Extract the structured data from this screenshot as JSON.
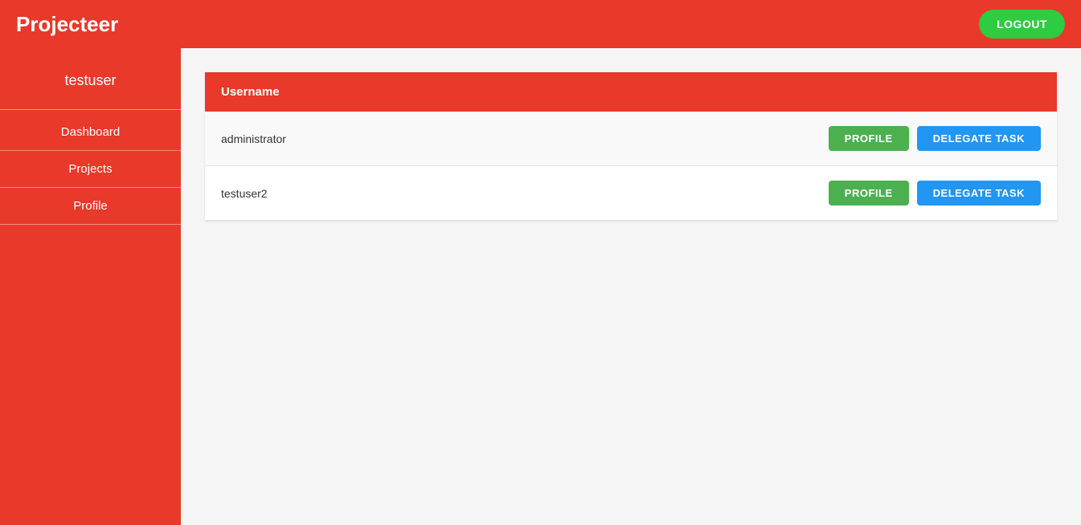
{
  "app": {
    "title": "Projecteer",
    "logout_label": "LOGOUT"
  },
  "sidebar": {
    "username": "testuser",
    "nav": [
      {
        "label": "Dashboard",
        "href": "#"
      },
      {
        "label": "Projects",
        "href": "#"
      },
      {
        "label": "Profile",
        "href": "#"
      }
    ]
  },
  "table": {
    "header": "Username",
    "rows": [
      {
        "username": "administrator",
        "profile_label": "PROFILE",
        "delegate_label": "DELEGATE TASK"
      },
      {
        "username": "testuser2",
        "profile_label": "PROFILE",
        "delegate_label": "DELEGATE TASK"
      }
    ]
  }
}
